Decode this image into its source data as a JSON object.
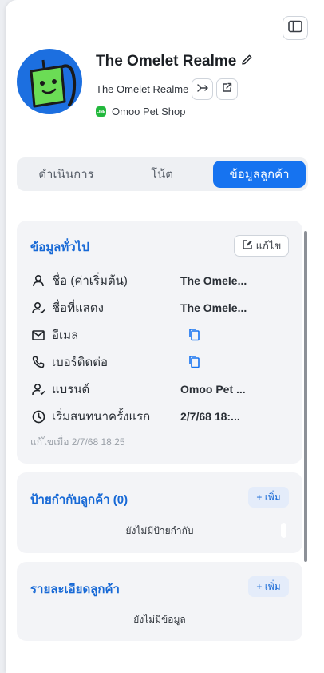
{
  "header": {
    "toggle_icon": "sidebar-panel-icon",
    "title": "The Omelet Realme",
    "subtitle_name": "The Omelet Realme",
    "merge_icon": "merge-arrow-icon",
    "external_icon": "external-link-icon",
    "shop_channel_icon": "line-icon",
    "shop_channel_badge": "LINE",
    "shop_name": "Omoo Pet Shop"
  },
  "tabs": [
    {
      "label": "ดำเนินการ",
      "active": false
    },
    {
      "label": "โน้ต",
      "active": false
    },
    {
      "label": "ข้อมูลลูกค้า",
      "active": true
    }
  ],
  "general_info": {
    "title": "ข้อมูลทั่วไป",
    "edit_label": "แก้ไข",
    "fields": [
      {
        "icon": "user-icon",
        "label": "ชื่อ (ค่าเริ่มต้น)",
        "value": "The Omele..."
      },
      {
        "icon": "user-check-icon",
        "label": "ชื่อที่แสดง",
        "value": "The Omele..."
      },
      {
        "icon": "mail-icon",
        "label": "อีเมล",
        "value": ""
      },
      {
        "icon": "phone-icon",
        "label": "เบอร์ติดต่อ",
        "value": ""
      },
      {
        "icon": "user-check-icon",
        "label": "แบรนด์",
        "value": "Omoo Pet ..."
      },
      {
        "icon": "clock-icon",
        "label": "เริ่มสนทนาครั้งแรก",
        "value": "2/7/68 18:..."
      }
    ],
    "edited_note": "แก้ไขเมื่อ 2/7/68 18:25"
  },
  "tags": {
    "title": "ป้ายกำกับลูกค้า (0)",
    "add_label": "+ เพิ่ม",
    "empty_text": "ยังไม่มีป้ายกำกับ"
  },
  "details": {
    "title": "รายละเอียดลูกค้า",
    "add_label": "+ เพิ่ม",
    "empty_text": "ยังไม่มีข้อมูล"
  },
  "colors": {
    "accent": "#1673f0",
    "title_blue": "#1769d6",
    "avatar_bg": "#1c6fe0",
    "mascot_green": "#6bdc55",
    "line_green": "#22b83c"
  }
}
